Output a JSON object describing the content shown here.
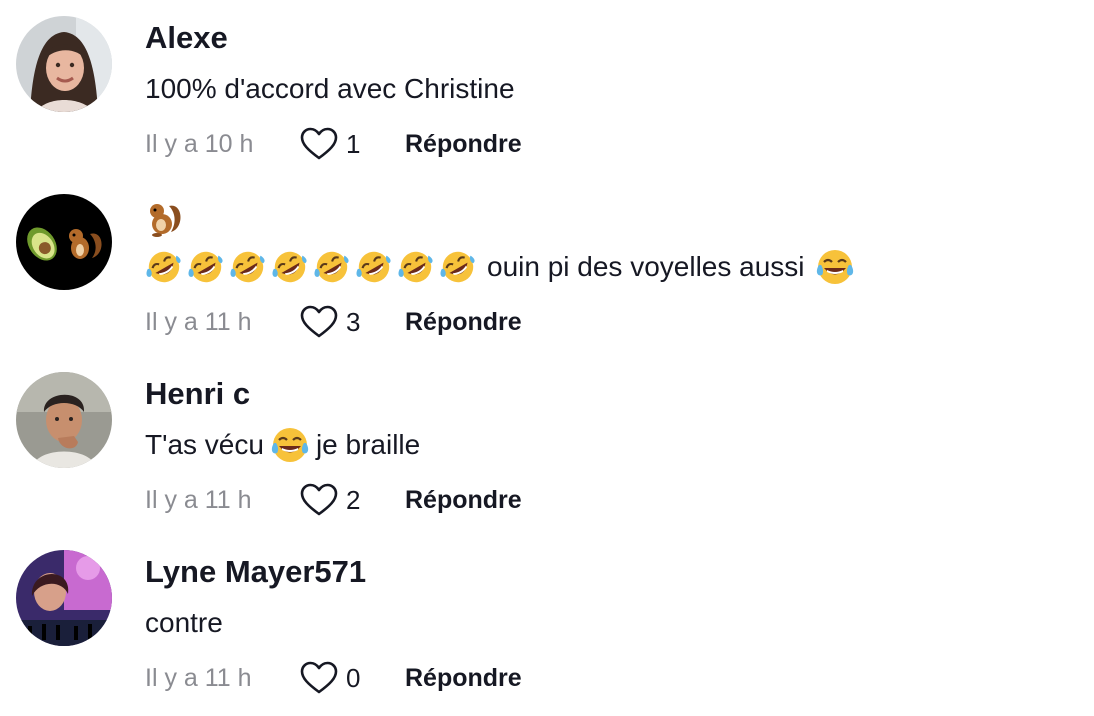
{
  "comments": [
    {
      "username": "Alexe",
      "text": "100% d'accord avec Christine",
      "time": "Il y a 10 h",
      "likes": "1",
      "reply": "Répondre",
      "avatar_icon": "profile-photo-woman"
    },
    {
      "username_icon": "chipmunk-emoji",
      "text_emoji_icon": "rolling-on-floor-laughing-emoji",
      "text_emoji_count": 8,
      "text": "ouin pi des voyelles aussi",
      "text_trailing_icon": "face-with-tears-of-joy-emoji",
      "time": "Il y a 11 h",
      "likes": "3",
      "reply": "Répondre",
      "avatar_icon": "avocado-chipmunk-avatar"
    },
    {
      "username": "Henri c",
      "text_before": "T'as vécu",
      "text_icon": "face-with-tears-of-joy-emoji",
      "text_after": "je braille",
      "time": "Il y a 11 h",
      "likes": "2",
      "reply": "Répondre",
      "avatar_icon": "profile-photo-man"
    },
    {
      "username": "Lyne Mayer571",
      "text": "contre",
      "time": "Il y a 11 h",
      "likes": "0",
      "reply": "Répondre",
      "avatar_icon": "profile-photo-concert"
    }
  ],
  "colors": {
    "text": "#161823",
    "muted": "#8a8b91",
    "heart_outline": "#161823"
  }
}
